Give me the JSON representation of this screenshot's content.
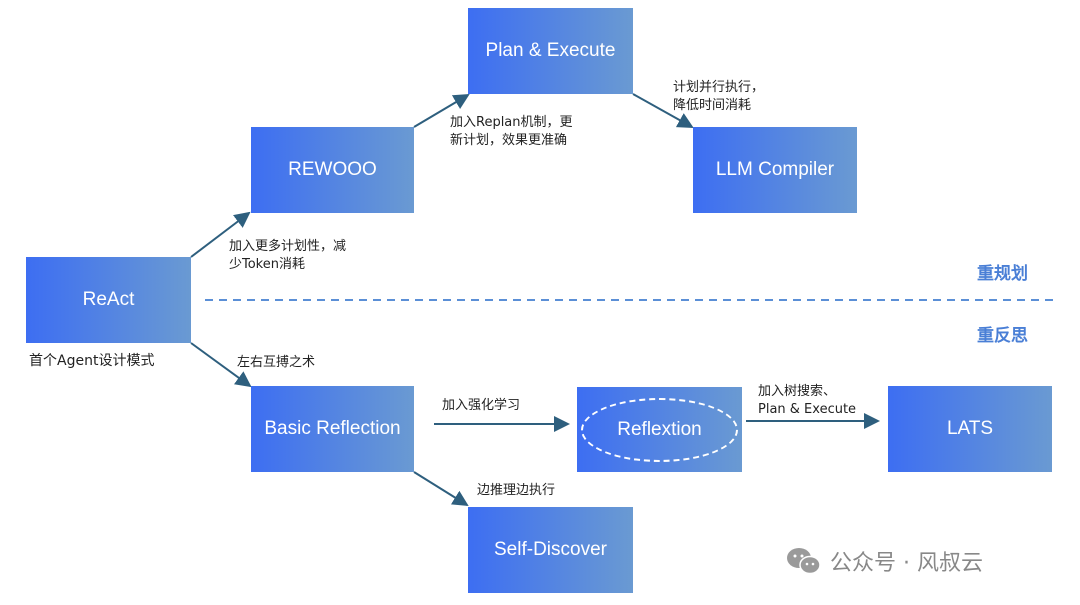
{
  "nodes": {
    "react": "ReAct",
    "rewooo": "REWOOO",
    "plan_execute": "Plan & Execute",
    "llm_compiler": "LLM Compiler",
    "basic_reflection": "Basic Reflection",
    "reflextion": "Reflextion",
    "lats": "LATS",
    "self_discover": "Self-Discover"
  },
  "edge_labels": {
    "react_note": "首个Agent设计模式",
    "react_to_rewooo": [
      "加入更多计划性，减",
      "少Token消耗"
    ],
    "rewooo_to_plan": [
      "加入Replan机制，更",
      "新计划，效果更准确"
    ],
    "plan_to_llm": [
      "计划并行执行，",
      "降低时间消耗"
    ],
    "react_to_basic": "左右互搏之术",
    "basic_to_reflextion": "加入强化学习",
    "reflextion_to_lats": [
      "加入树搜索、",
      "Plan & Execute"
    ],
    "basic_to_self": "边推理边执行"
  },
  "sections": {
    "top": "重规划",
    "bottom": "重反思"
  },
  "watermark": {
    "icon": "wechat-icon",
    "text": "公众号 · 风叔云"
  },
  "colors": {
    "node_start": "#3d6ef2",
    "node_end": "#6a9ad2",
    "arrow": "#2e5f7e",
    "divider": "#5b8fd6",
    "section_text": "#4a7fd6"
  }
}
